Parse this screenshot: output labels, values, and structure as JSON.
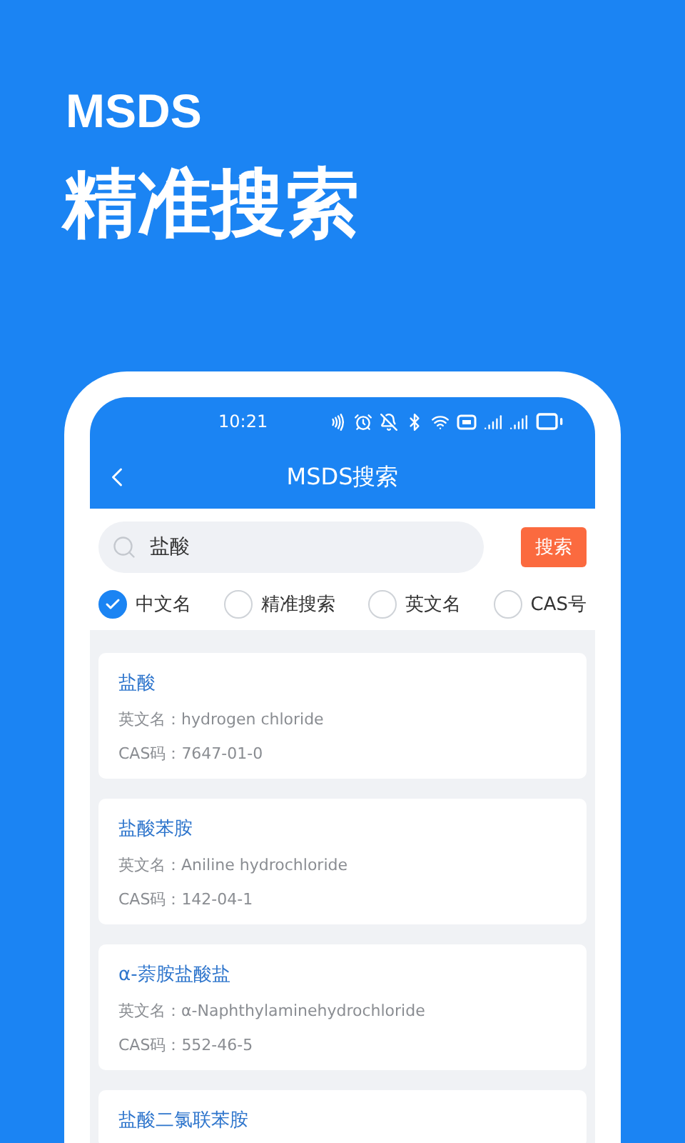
{
  "hero": {
    "brand": "MSDS",
    "headline": "精准搜索"
  },
  "status_bar": {
    "time": "10:21"
  },
  "nav": {
    "title": "MSDS搜索"
  },
  "search": {
    "value": "盐酸",
    "button": "搜索"
  },
  "options": [
    {
      "label": "中文名",
      "selected": true
    },
    {
      "label": "精准搜索",
      "selected": false
    },
    {
      "label": "英文名",
      "selected": false
    },
    {
      "label": "CAS号",
      "selected": false
    }
  ],
  "results": [
    {
      "name": "盐酸",
      "english": "英文名：hydrogen chloride",
      "cas": "CAS码：7647-01-0"
    },
    {
      "name": "盐酸苯胺",
      "english": "英文名：Aniline hydrochloride",
      "cas": "CAS码：142-04-1"
    },
    {
      "name": "α-萘胺盐酸盐",
      "english": "英文名：α-Naphthylaminehydrochloride",
      "cas": "CAS码：552-46-5"
    },
    {
      "name": "盐酸二氯联苯胺"
    }
  ]
}
